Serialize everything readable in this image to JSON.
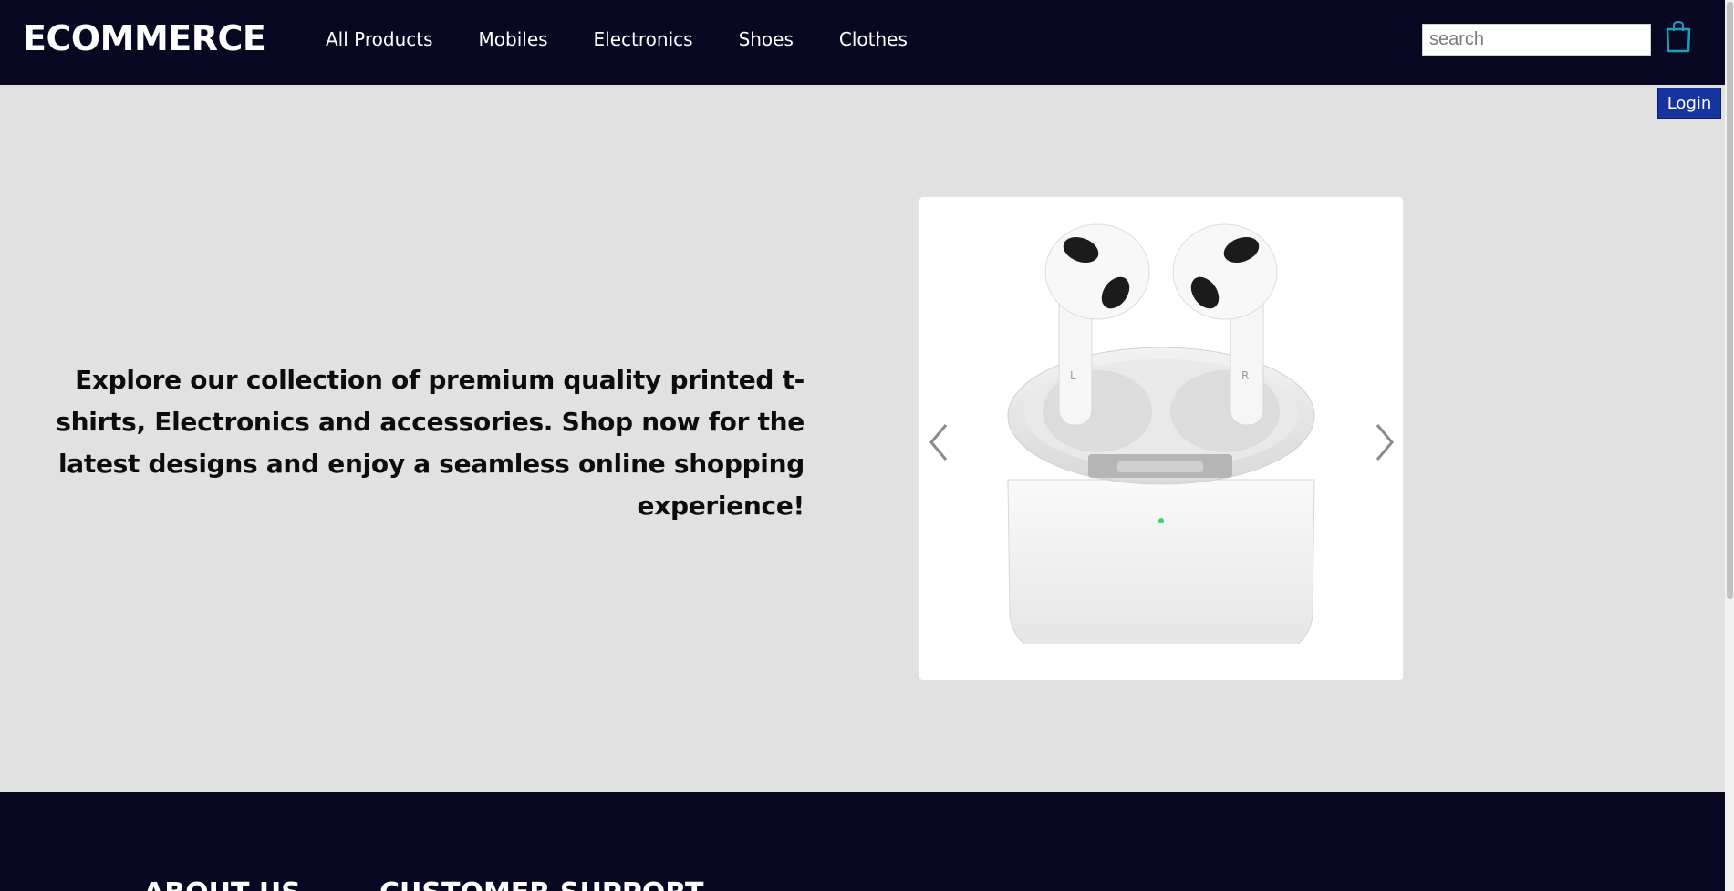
{
  "header": {
    "brand": "ECOMMERCE",
    "nav": [
      "All Products",
      "Mobiles",
      "Electronics",
      "Shoes",
      "Clothes"
    ],
    "search_placeholder": "search",
    "cart_icon": "shopping-bag-icon"
  },
  "login_label": "Login",
  "hero": {
    "text": "Explore our collection of premium quality printed t-shirts, Electronics and accessories. Shop now for the latest designs and enjoy a seamless online shopping experience!",
    "carousel": {
      "image_name": "airpods-product-image",
      "prev_icon": "chevron-left-icon",
      "next_icon": "chevron-right-icon"
    }
  },
  "footer": {
    "headings": [
      "ABOUT US",
      "CUSTOMER SUPPORT"
    ]
  },
  "colors": {
    "header_bg": "#080822",
    "body_bg": "#e1e1e1",
    "login_bg": "#1634a0",
    "cart_accent": "#1aa0b8"
  }
}
